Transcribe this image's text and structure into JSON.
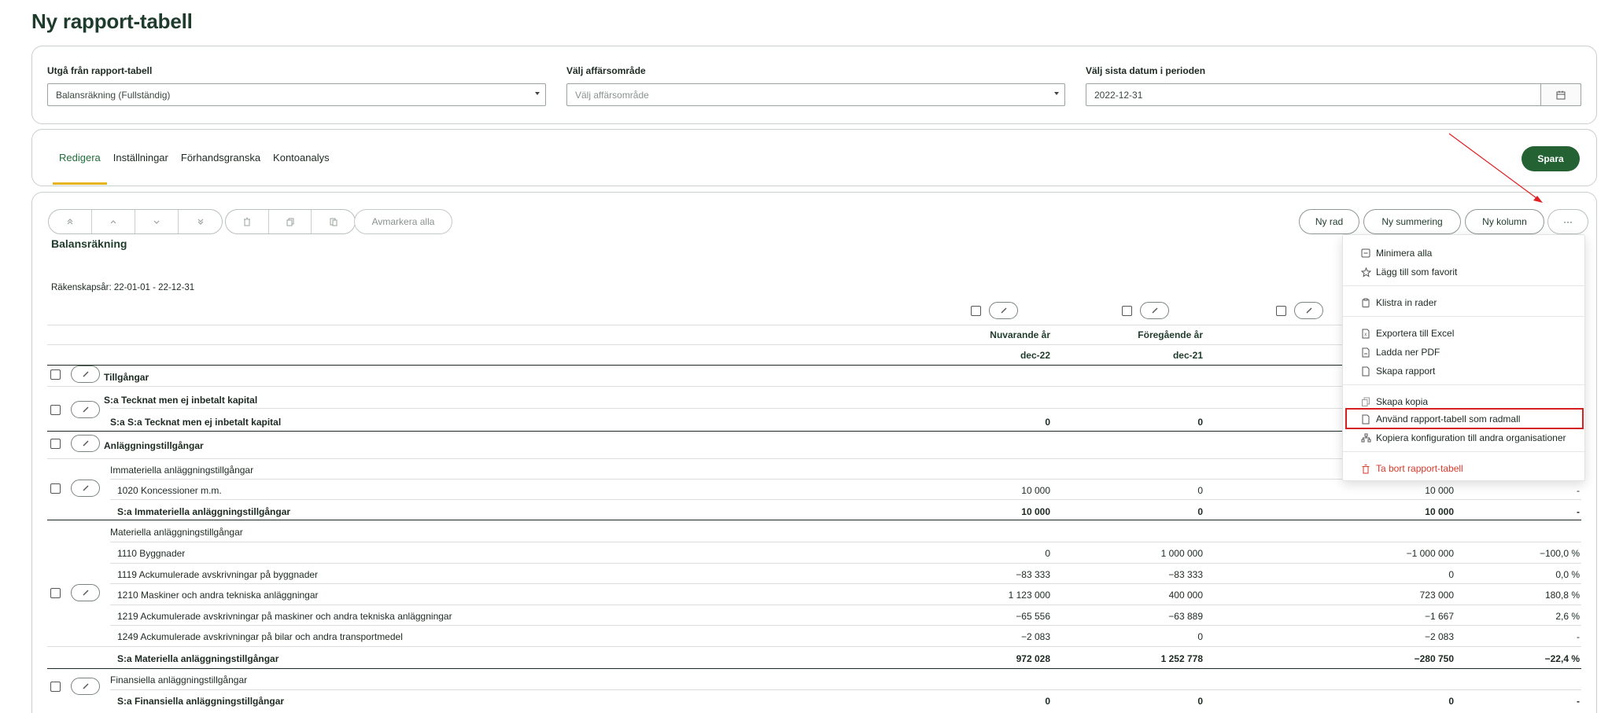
{
  "page": {
    "title": "Ny rapport-tabell"
  },
  "filters": {
    "base_label": "Utgå från rapport-tabell",
    "base_value": "Balansräkning (Fullständig)",
    "area_label": "Välj affärsområde",
    "area_placeholder": "Välj affärsområde",
    "date_label": "Välj sista datum i perioden",
    "date_value": "2022-12-31"
  },
  "tabs": [
    {
      "label": "Redigera",
      "active": true
    },
    {
      "label": "Inställningar"
    },
    {
      "label": "Förhandsgranska"
    },
    {
      "label": "Kontoanalys"
    }
  ],
  "save_label": "Spara",
  "toolbar": {
    "deselect_all": "Avmarkera alla",
    "new_row": "Ny rad",
    "new_sum": "Ny summering",
    "new_column": "Ny kolumn",
    "more": "···"
  },
  "report": {
    "title": "Balansräkning",
    "fiscal_year": "Räkenskapsår:  22-01-01 - 22-12-31",
    "columns": [
      {
        "name": "Nuvarande år",
        "period": "dec-22"
      },
      {
        "name": "Föregående år",
        "period": "dec-21"
      }
    ],
    "rows": [
      {
        "label": "Tillgångar",
        "values": [
          "",
          "",
          "",
          ""
        ]
      },
      {
        "label": "S:a Tecknat men ej inbetalt kapital",
        "values": [
          "",
          "",
          "",
          ""
        ]
      },
      {
        "label": "S:a S:a Tecknat men ej inbetalt kapital",
        "values": [
          "0",
          "0",
          "",
          ""
        ]
      },
      {
        "label": "Anläggningstillgångar",
        "values": [
          "",
          "",
          "",
          ""
        ]
      },
      {
        "label": "Immateriella anläggningstillgångar",
        "values": [
          "",
          "",
          "",
          ""
        ]
      },
      {
        "label": "1020 Koncessioner m.m.",
        "values": [
          "10 000",
          "0",
          "10 000",
          "-"
        ]
      },
      {
        "label": "S:a Immateriella anläggningstillgångar",
        "values": [
          "10 000",
          "0",
          "10 000",
          "-"
        ]
      },
      {
        "label": "Materiella anläggningstillgångar",
        "values": [
          "",
          "",
          "",
          ""
        ]
      },
      {
        "label": "1110 Byggnader",
        "values": [
          "0",
          "1 000 000",
          "−1 000 000",
          "−100,0 %"
        ]
      },
      {
        "label": "1119 Ackumulerade avskrivningar på byggnader",
        "values": [
          "−83 333",
          "−83 333",
          "0",
          "0,0 %"
        ]
      },
      {
        "label": "1210 Maskiner och andra tekniska anläggningar",
        "values": [
          "1 123 000",
          "400 000",
          "723 000",
          "180,8 %"
        ]
      },
      {
        "label": "1219 Ackumulerade avskrivningar på maskiner och andra tekniska anläggningar",
        "values": [
          "−65 556",
          "−63 889",
          "−1 667",
          "2,6 %"
        ]
      },
      {
        "label": "1249 Ackumulerade avskrivningar på bilar och andra transportmedel",
        "values": [
          "−2 083",
          "0",
          "−2 083",
          "-"
        ]
      },
      {
        "label": "S:a Materiella anläggningstillgångar",
        "values": [
          "972 028",
          "1 252 778",
          "−280 750",
          "−22,4 %"
        ]
      },
      {
        "label": "Finansiella anläggningstillgångar",
        "values": [
          "",
          "",
          "",
          ""
        ]
      },
      {
        "label": "S:a Finansiella anläggningstillgångar",
        "values": [
          "0",
          "0",
          "0",
          "-"
        ]
      }
    ]
  },
  "menu": {
    "items": [
      {
        "label": "Minimera alla",
        "icon": "minimize-icon"
      },
      {
        "label": "Lägg till som favorit",
        "icon": "star-icon"
      },
      {
        "label": "Klistra in rader",
        "icon": "clipboard-icon"
      },
      {
        "label": "Exportera till Excel",
        "icon": "excel-file-icon"
      },
      {
        "label": "Ladda ner PDF",
        "icon": "pdf-file-icon"
      },
      {
        "label": "Skapa rapport",
        "icon": "document-icon"
      },
      {
        "label": "Skapa kopia",
        "icon": "copy-icon"
      },
      {
        "label": "Använd rapport-tabell som radmall",
        "icon": "document-icon"
      },
      {
        "label": "Kopiera konfiguration till andra organisationer",
        "icon": "org-icon"
      },
      {
        "label": "Ta bort rapport-tabell",
        "icon": "trash-icon"
      }
    ]
  },
  "colors": {
    "primary": "#246133",
    "accent": "#e6b51e",
    "danger": "#d33a2c",
    "annotation": "#d42020"
  }
}
